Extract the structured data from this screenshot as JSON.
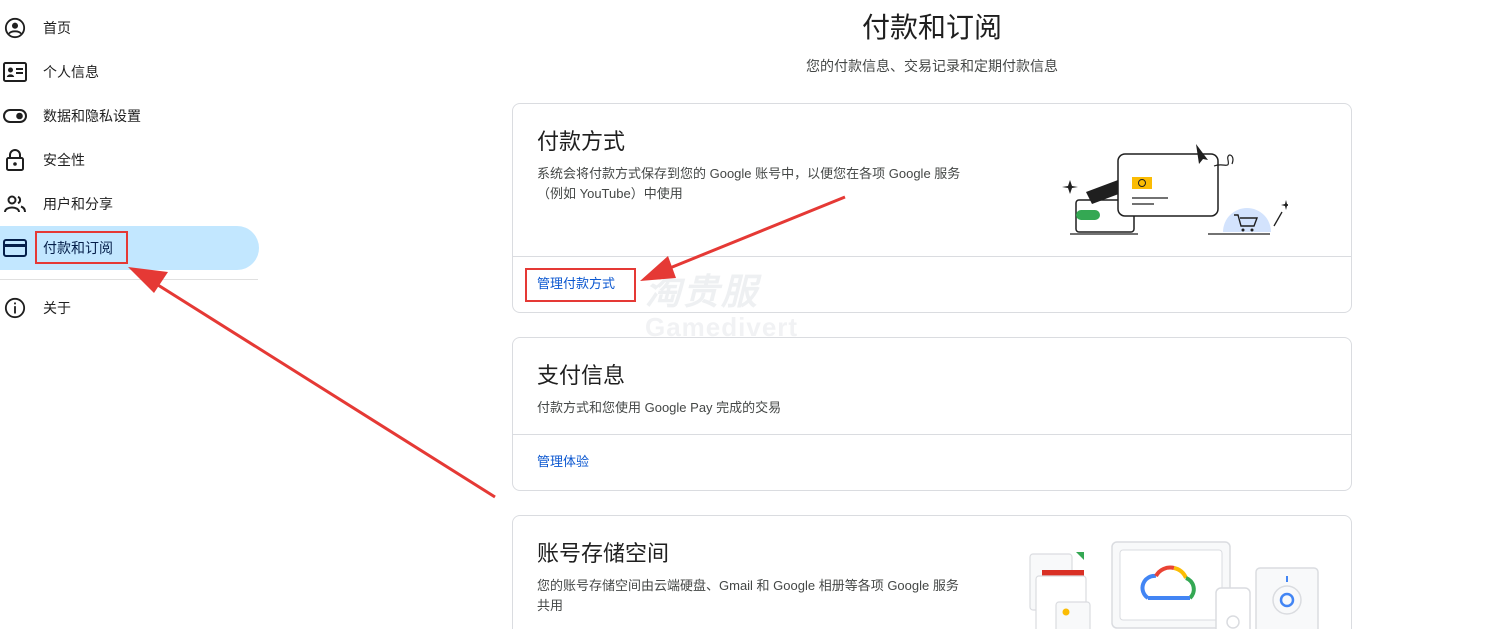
{
  "sidebar": {
    "items": [
      {
        "label": "首页",
        "icon": "account-circle-icon"
      },
      {
        "label": "个人信息",
        "icon": "id-card-icon"
      },
      {
        "label": "数据和隐私设置",
        "icon": "toggle-icon"
      },
      {
        "label": "安全性",
        "icon": "lock-icon"
      },
      {
        "label": "用户和分享",
        "icon": "people-icon"
      },
      {
        "label": "付款和订阅",
        "icon": "credit-card-icon",
        "active": true
      },
      {
        "label": "关于",
        "icon": "info-icon"
      }
    ]
  },
  "header": {
    "title": "付款和订阅",
    "subtitle": "您的付款信息、交易记录和定期付款信息"
  },
  "cards": {
    "payment_methods": {
      "title": "付款方式",
      "desc_line1": "系统会将付款方式保存到您的 Google 账号中，以便您在各项 Google 服务",
      "desc_line2": "（例如 YouTube）中使用",
      "link": "管理付款方式"
    },
    "payment_info": {
      "title": "支付信息",
      "desc": "付款方式和您使用 Google Pay 完成的交易",
      "link": "管理体验"
    },
    "storage": {
      "title": "账号存储空间",
      "desc_line1": "您的账号存储空间由云端硬盘、Gmail 和 Google 相册等各项 Google 服务",
      "desc_line2": "共用"
    }
  },
  "watermark": {
    "line1": "淘贵服",
    "line2": "Gamedivert"
  },
  "colors": {
    "accent": "#0b57d0",
    "active_bg": "#c2e7ff",
    "annotation_red": "#e53935"
  }
}
